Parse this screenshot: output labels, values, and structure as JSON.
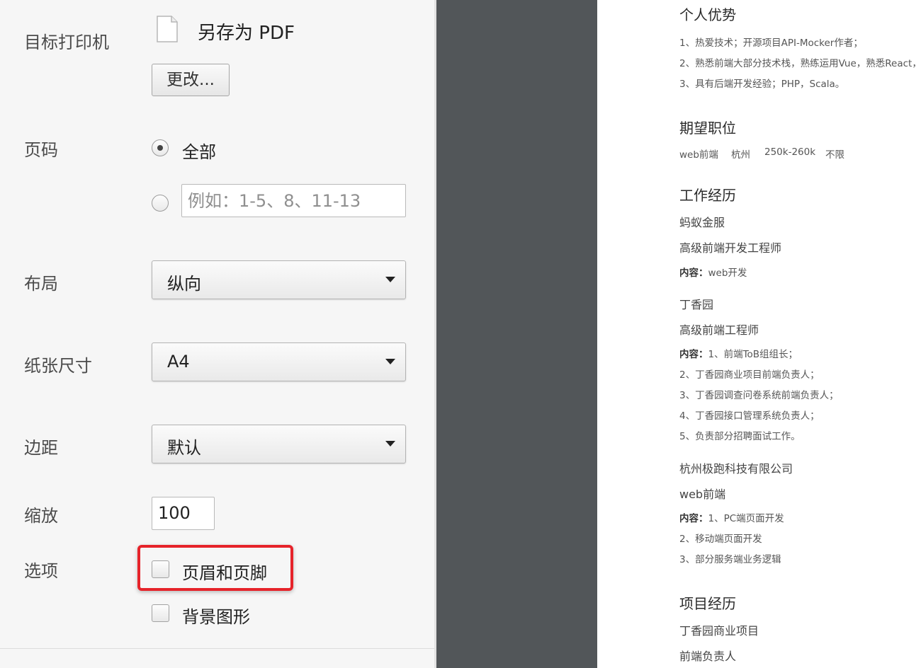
{
  "print_settings": {
    "destination": {
      "label": "目标打印机",
      "name": "另存为 PDF",
      "change_button": "更改..."
    },
    "pages": {
      "label": "页码",
      "all_label": "全部",
      "all_selected": true,
      "custom_placeholder": "例如：1-5、8、11-13"
    },
    "layout": {
      "label": "布局",
      "value": "纵向"
    },
    "paper_size": {
      "label": "纸张尺寸",
      "value": "A4"
    },
    "margins": {
      "label": "边距",
      "value": "默认"
    },
    "scale": {
      "label": "缩放",
      "value": "100"
    },
    "options": {
      "label": "选项",
      "headers_footers": {
        "label": "页眉和页脚",
        "checked": false
      },
      "background_graphics": {
        "label": "背景图形",
        "checked": false
      }
    },
    "highlight_color": "#e6232a"
  },
  "preview": {
    "advantages": {
      "heading": "个人优势",
      "items": [
        "1、热爱技术；开源项目API-Mocker作者；",
        "2、熟悉前端大部分技术栈，熟练运用Vue，熟悉React，",
        "3、具有后端开发经验；PHP，Scala。"
      ]
    },
    "expectation": {
      "heading": "期望职位",
      "items": [
        "web前端",
        "杭州",
        "250k-260k",
        "不限"
      ]
    },
    "work": {
      "heading": "工作经历",
      "jobs": [
        {
          "company": "蚂蚁金服",
          "title": "高级前端开发工程师",
          "content_label": "内容：",
          "content_lines": [
            "web开发"
          ]
        },
        {
          "company": "丁香园",
          "title": "高级前端工程师",
          "content_label": "内容：",
          "content_lines": [
            "1、前端ToB组组长；",
            "2、丁香园商业项目前端负责人；",
            "3、丁香园调查问卷系统前端负责人；",
            "4、丁香园接口管理系统负责人；",
            "5、负责部分招聘面试工作。"
          ]
        },
        {
          "company": "杭州极跑科技有限公司",
          "title": "web前端",
          "content_label": "内容：",
          "content_lines": [
            "1、PC端页面开发",
            "2、移动端页面开发",
            "3、部分服务端业务逻辑"
          ]
        }
      ]
    },
    "projects": {
      "heading": "项目经历",
      "name": "丁香园商业项目",
      "role": "前端负责人"
    }
  }
}
